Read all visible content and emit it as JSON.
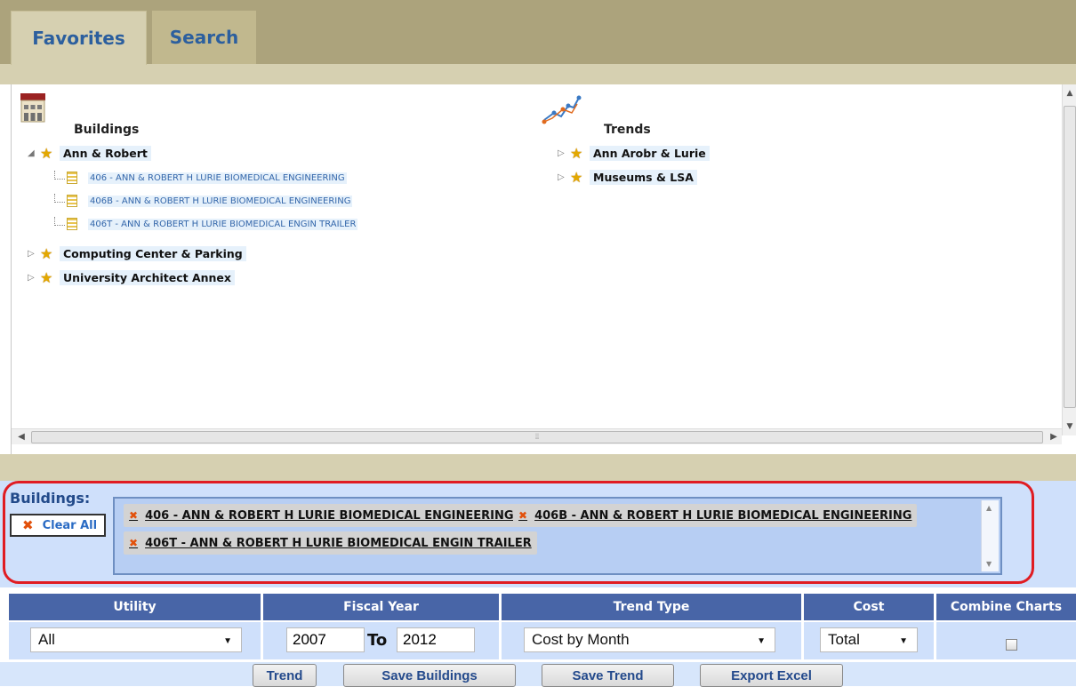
{
  "tabs": [
    {
      "label": "Favorites",
      "active": true
    },
    {
      "label": "Search",
      "active": false
    }
  ],
  "favorites": {
    "buildings": {
      "title": "Buildings",
      "groups": [
        {
          "label": "Ann & Robert",
          "expanded": true,
          "children": [
            "406 - ANN & ROBERT H LURIE BIOMEDICAL ENGINEERING",
            "406B - ANN & ROBERT H LURIE BIOMEDICAL ENGINEERING",
            "406T - ANN & ROBERT H LURIE BIOMEDICAL ENGIN TRAILER"
          ]
        },
        {
          "label": "Computing Center & Parking",
          "expanded": false
        },
        {
          "label": "University Architect Annex",
          "expanded": false
        }
      ]
    },
    "trends": {
      "title": "Trends",
      "groups": [
        {
          "label": "Ann Arobr & Lurie",
          "expanded": false
        },
        {
          "label": "Museums & LSA",
          "expanded": false
        }
      ]
    }
  },
  "selection": {
    "label": "Buildings:",
    "clear_all": "Clear All",
    "chips": [
      "406 - ANN & ROBERT H LURIE BIOMEDICAL ENGINEERING",
      "406B - ANN & ROBERT H LURIE BIOMEDICAL ENGINEERING",
      "406T - ANN & ROBERT H LURIE BIOMEDICAL ENGIN TRAILER"
    ]
  },
  "filters": {
    "headers": {
      "utility": "Utility",
      "fiscal_year": "Fiscal Year",
      "trend_type": "Trend Type",
      "cost": "Cost",
      "combine": "Combine Charts"
    },
    "utility": "All",
    "fy_from": "2007",
    "to_label": "To",
    "fy_to": "2012",
    "trend_type": "Cost by Month",
    "cost": "Total",
    "combine_checked": false
  },
  "buttons": {
    "trend": "Trend",
    "save_buildings": "Save Buildings",
    "save_trend": "Save Trend",
    "export_excel": "Export Excel"
  },
  "colors": {
    "header_bar": "#aca37c",
    "table_header": "#4865a7",
    "selection_bg": "#cfe0fb",
    "highlight_ring": "#e01c22",
    "remove_icon": "#e2500a"
  }
}
